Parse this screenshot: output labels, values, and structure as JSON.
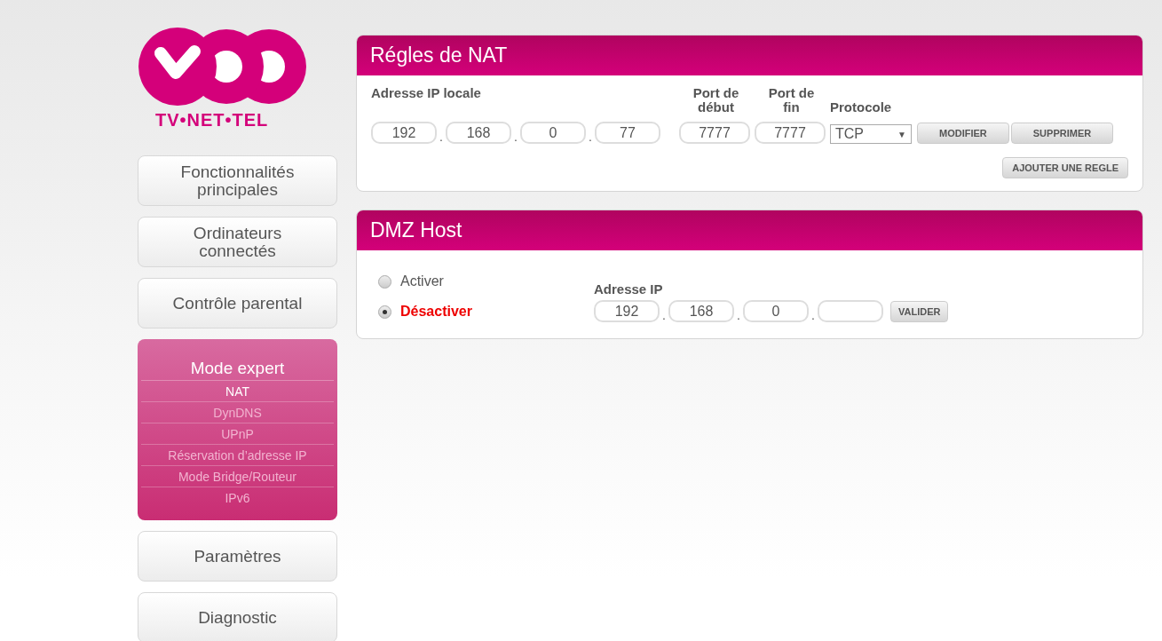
{
  "logo": {
    "tagline": "TV•NET•TEL"
  },
  "sidebar": {
    "items": [
      {
        "kind": "button",
        "label": "Fonctionnalités principales"
      },
      {
        "kind": "button",
        "label": "Ordinateurs connectés"
      },
      {
        "kind": "button",
        "label": "Contrôle parental"
      },
      {
        "kind": "group",
        "label": "Mode expert",
        "children": [
          {
            "label": "NAT",
            "selected": true
          },
          {
            "label": "DynDNS",
            "selected": false
          },
          {
            "label": "UPnP",
            "selected": false
          },
          {
            "label": "Réservation d’adresse IP",
            "selected": false
          },
          {
            "label": "Mode Bridge/Routeur",
            "selected": false
          },
          {
            "label": "IPv6",
            "selected": false
          }
        ]
      },
      {
        "kind": "button",
        "label": "Paramètres"
      },
      {
        "kind": "button",
        "label": "Diagnostic"
      }
    ]
  },
  "nat": {
    "title": "Régles de NAT",
    "labels": {
      "ip": "Adresse IP locale",
      "port_start": "Port de début",
      "port_end": "Port de fin",
      "protocol": "Protocole"
    },
    "ip": [
      "192",
      "168",
      "0",
      "77"
    ],
    "separator": ".",
    "port_start": "7777",
    "port_end": "7777",
    "protocol": {
      "value": "TCP",
      "arrow": "▼"
    },
    "buttons": [
      "MODIFIER",
      "SUPPRIMER"
    ],
    "add_button": "AJOUTER UNE REGLE"
  },
  "dmz": {
    "title": "DMZ Host",
    "options": [
      {
        "label": "Activer",
        "selected": false
      },
      {
        "label": "Désactiver",
        "selected": true
      }
    ],
    "ip_label": "Adresse IP",
    "ip": [
      {
        "kind": "octet",
        "value": "192"
      },
      {
        "kind": "octet",
        "value": "168"
      },
      {
        "kind": "octet",
        "value": "0"
      },
      {
        "kind": "blank"
      }
    ],
    "separator": ".",
    "button": "VALIDER"
  }
}
